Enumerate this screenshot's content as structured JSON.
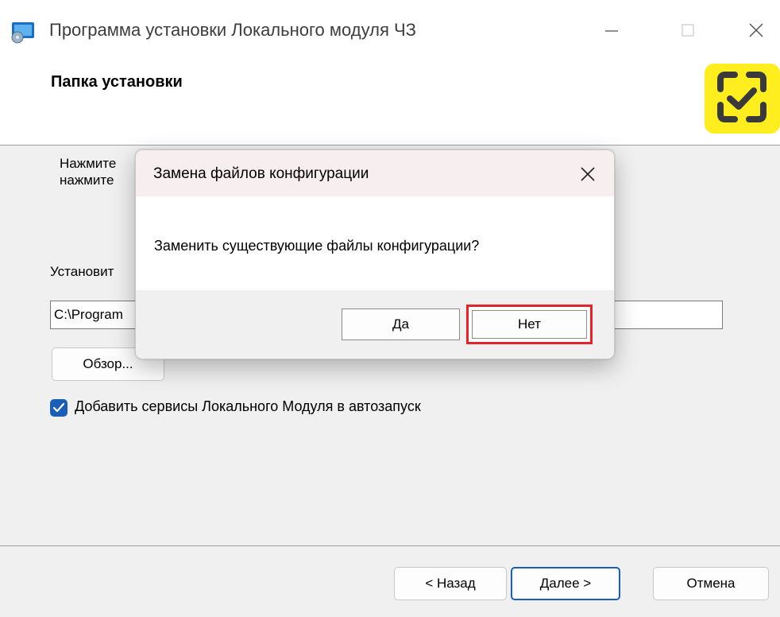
{
  "window": {
    "title": "Программа установки Локального модуля ЧЗ",
    "header_title": "Папка установки",
    "intro_text": "Нажмите\nнажмите",
    "folder_label": "Установит",
    "path_value": "C:\\Program",
    "browse_label": "Обзор...",
    "autostart_label": "Добавить сервисы Локального Модуля в автозапуск",
    "autostart_checked": true,
    "buttons": {
      "back": "< Назад",
      "next": "Далее >",
      "cancel": "Отмена"
    }
  },
  "dialog": {
    "title": "Замена файлов конфигурации",
    "message": "Заменить существующие файлы конфигурации?",
    "yes_label": "Да",
    "no_label": "Нет"
  },
  "colors": {
    "logo_background": "#ffee1f",
    "accent": "#1a5fb4",
    "highlight": "#e0262d"
  },
  "icons": [
    "installer-app-icon",
    "minimize-icon",
    "maximize-icon",
    "close-icon",
    "chestny-znak-logo-icon",
    "checkmark-icon"
  ]
}
